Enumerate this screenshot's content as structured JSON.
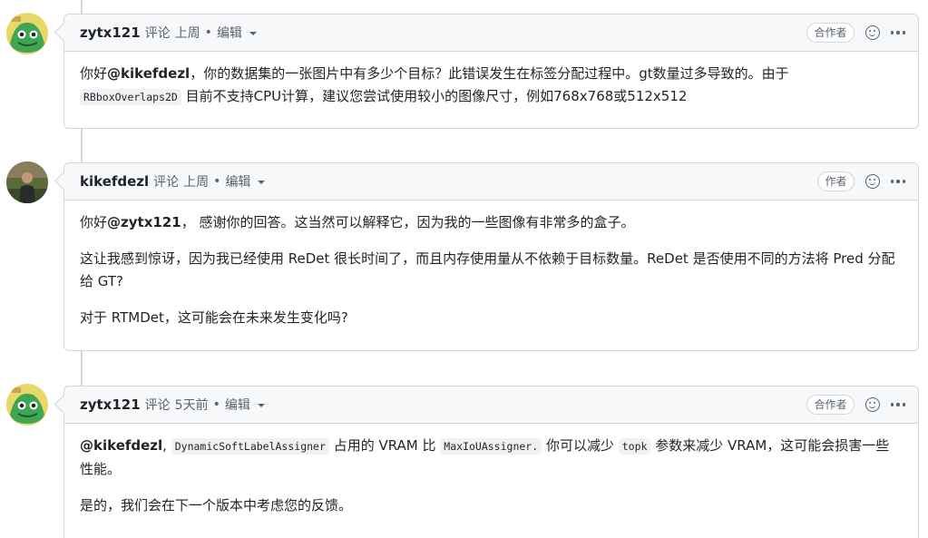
{
  "comments": [
    {
      "author": "zytx121",
      "action": "评论",
      "time": "上周",
      "sep": "•",
      "edited": "编辑",
      "badge": "合作者",
      "body": {
        "p1_a": "你好",
        "p1_mention": "@kikefdezl",
        "p1_b": "，你的数据集的一张图片中有多少个目标？此错误发生在标签分配过程中。gt数量过多导致的。由于",
        "p1_code": "RBboxOverlaps2D",
        "p1_c": "目前不支持CPU计算，建议您尝试使用较小的图像尺寸，例如768x768或512x512"
      }
    },
    {
      "author": "kikefdezl",
      "action": "评论",
      "time": "上周",
      "sep": "•",
      "edited": "编辑",
      "badge": "作者",
      "body": {
        "p1_a": "你好",
        "p1_mention": "@zytx121",
        "p1_b": "， 感谢你的回答。这当然可以解释它，因为我的一些图像有非常多的盒子。",
        "p2": "这让我感到惊讶，因为我已经使用 ReDet 很长时间了，而且内存使用量从不依赖于目标数量。ReDet 是否使用不同的方法将 Pred 分配给 GT?",
        "p3": "对于 RTMDet，这可能会在未来发生变化吗?"
      }
    },
    {
      "author": "zytx121",
      "action": "评论",
      "time": "5天前",
      "sep": "•",
      "edited": "编辑",
      "badge": "合作者",
      "body": {
        "p1_mention": "@kikefdezl",
        "p1_a": ",",
        "p1_code1": "DynamicSoftLabelAssigner",
        "p1_b": "占用的 VRAM 比",
        "p1_code2": "MaxIoUAssigner.",
        "p1_c": "你可以减少",
        "p1_code3": "topk",
        "p1_d": "参数来减少 VRAM，这可能会损害一些性能。",
        "p2": "是的，我们会在下一个版本中考虑您的反馈。"
      }
    }
  ],
  "colors": {
    "border": "#d0d7de",
    "header_bg": "#f6f8fa",
    "muted": "#59636e",
    "text": "#1f2328"
  }
}
